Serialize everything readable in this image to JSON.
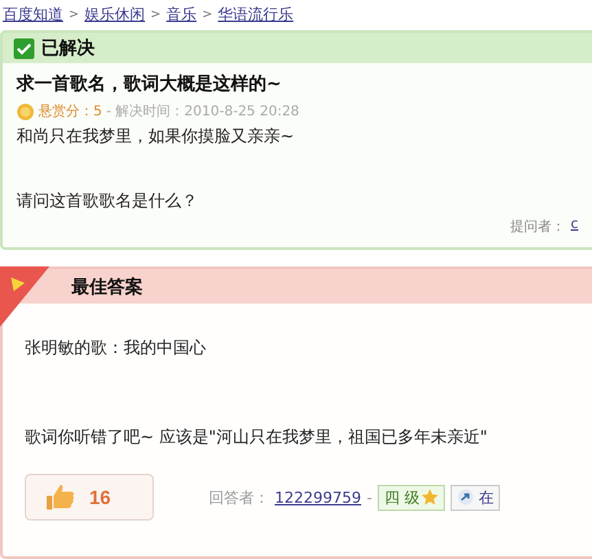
{
  "breadcrumb": [
    {
      "label": "百度知道"
    },
    {
      "label": "娱乐休闲"
    },
    {
      "label": "音乐"
    },
    {
      "label": "华语流行乐"
    }
  ],
  "breadcrumb_separator": ">",
  "question": {
    "status": "已解决",
    "title": "求一首歌名，歌词大概是这样的~",
    "reward": "悬赏分：5",
    "meta": "- 解决时间：2010-8-25 20:28",
    "body": [
      "和尚只在我梦里，如果你摸脸又亲亲~",
      "请问这首歌歌名是什么？"
    ],
    "asker_label": "提问者：",
    "asker": "c"
  },
  "best_answer": {
    "title": "最佳答案",
    "body": [
      "张明敏的歌：我的中国心",
      "歌词你听错了吧~  应该是\"河山只在我梦里，祖国已多年未亲近\""
    ],
    "likes": "16",
    "answerer_label": "回答者：",
    "answerer": "122299759",
    "separator": "-",
    "level": "四 级",
    "action": "在"
  }
}
